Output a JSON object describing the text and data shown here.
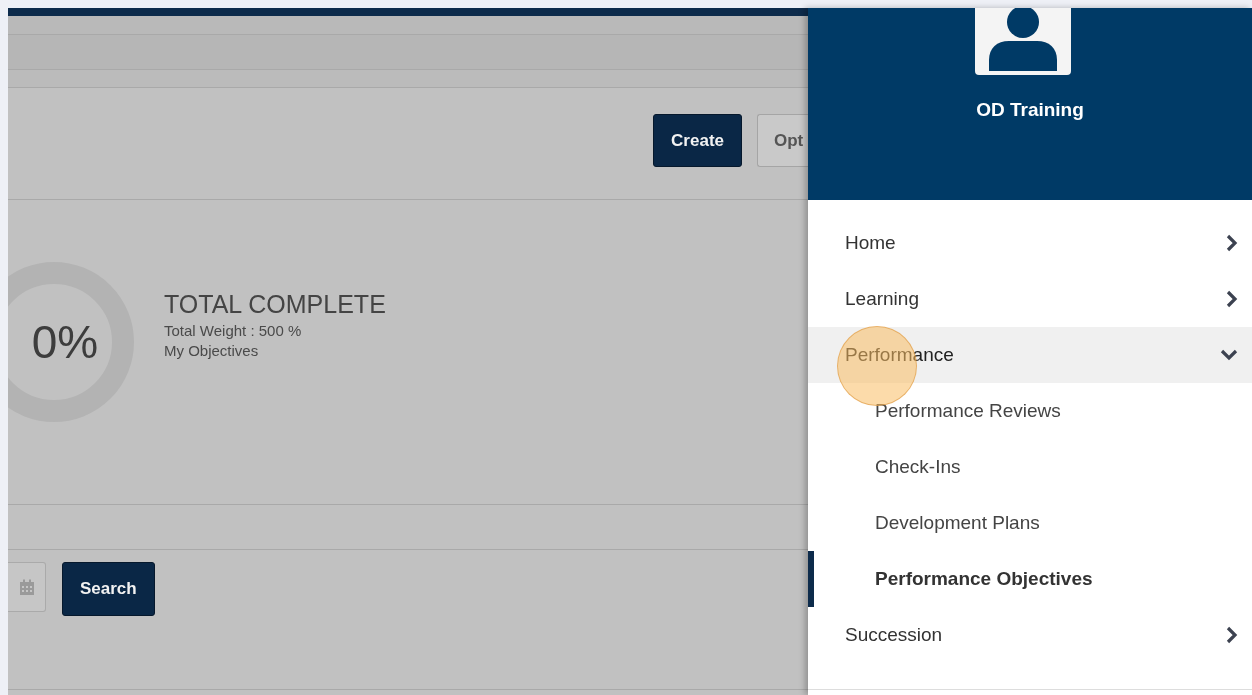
{
  "main": {
    "toolbar_buttons": [
      {
        "label": "Create",
        "kind": "primary"
      },
      {
        "label": "Opt",
        "kind": "secondary"
      }
    ],
    "summary": {
      "percent": "0%",
      "level": 0,
      "title": "TOTAL COMPLETE",
      "weight": "Total Weight : 500 %",
      "subtitle": "My Objectives"
    },
    "search_button": "Search"
  },
  "sidebar": {
    "user_name": "OD Training",
    "menu": [
      {
        "label": "Home",
        "expanded": false
      },
      {
        "label": "Learning",
        "expanded": false
      },
      {
        "label": "Performance",
        "expanded": true,
        "children": [
          {
            "label": "Performance Reviews",
            "selected": false
          },
          {
            "label": "Check-Ins",
            "selected": false
          },
          {
            "label": "Development Plans",
            "selected": false
          },
          {
            "label": "Performance Objectives",
            "selected": true
          }
        ]
      },
      {
        "label": "Succession",
        "expanded": false
      }
    ]
  }
}
